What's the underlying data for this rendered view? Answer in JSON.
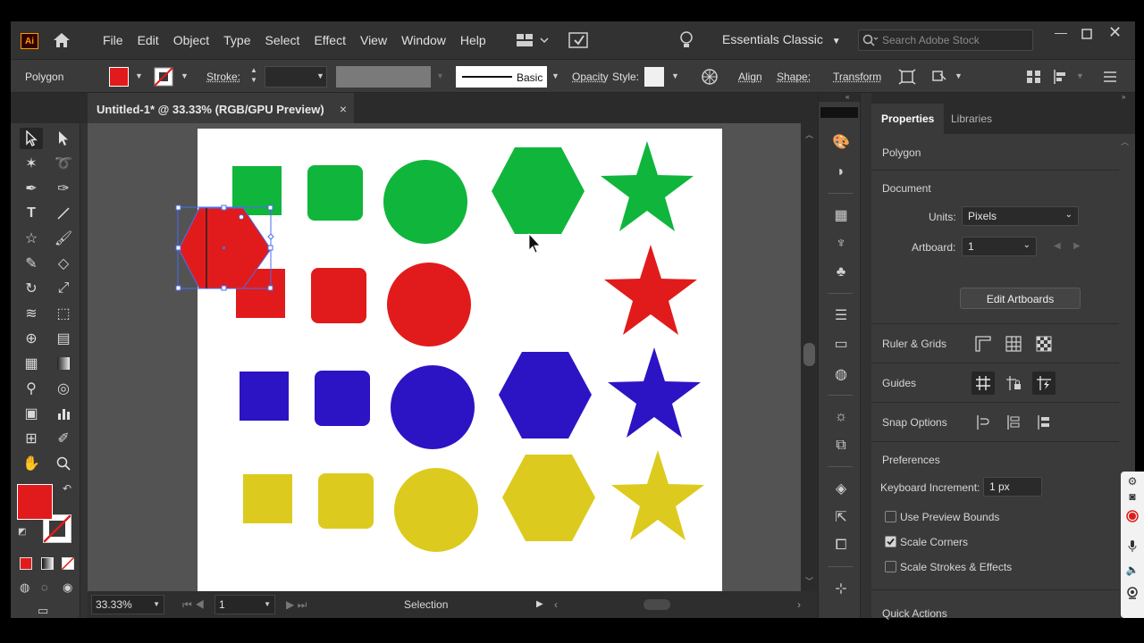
{
  "app": {
    "logo": "Ai",
    "menu": [
      "File",
      "Edit",
      "Object",
      "Type",
      "Select",
      "Effect",
      "View",
      "Window",
      "Help"
    ],
    "workspace": "Essentials Classic",
    "search_placeholder": "Search Adobe Stock"
  },
  "control_bar": {
    "selection_type": "Polygon",
    "fill_color": "#e11b1b",
    "stroke_label": "Stroke:",
    "brush_label": "Basic",
    "opacity_label": "Opacity",
    "style_label": "Style:",
    "align_label": "Align",
    "shape_label": "Shape:",
    "transform_label": "Transform"
  },
  "document": {
    "tab_title": "Untitled-1* @ 33.33% (RGB/GPU Preview)",
    "close_glyph": "×"
  },
  "status_bar": {
    "zoom": "33.33%",
    "artboard_number": "1",
    "tool": "Selection"
  },
  "colors": {
    "green": "#10b53c",
    "red": "#e11b1b",
    "blue": "#2c14c4",
    "yellow": "#dccb1e",
    "selection": "#4a6cf0"
  },
  "properties": {
    "tabs": [
      "Properties",
      "Libraries"
    ],
    "section_type": "Polygon",
    "document_header": "Document",
    "units_label": "Units:",
    "units_value": "Pixels",
    "artboard_label": "Artboard:",
    "artboard_value": "1",
    "edit_artboards": "Edit Artboards",
    "ruler_grids": "Ruler & Grids",
    "guides": "Guides",
    "snap_options": "Snap Options",
    "preferences": "Preferences",
    "keyboard_increment_label": "Keyboard Increment:",
    "keyboard_increment_value": "1 px",
    "use_preview_bounds": "Use Preview Bounds",
    "scale_corners": "Scale Corners",
    "scale_strokes_effects": "Scale Strokes & Effects",
    "quick_actions": "Quick Actions"
  }
}
